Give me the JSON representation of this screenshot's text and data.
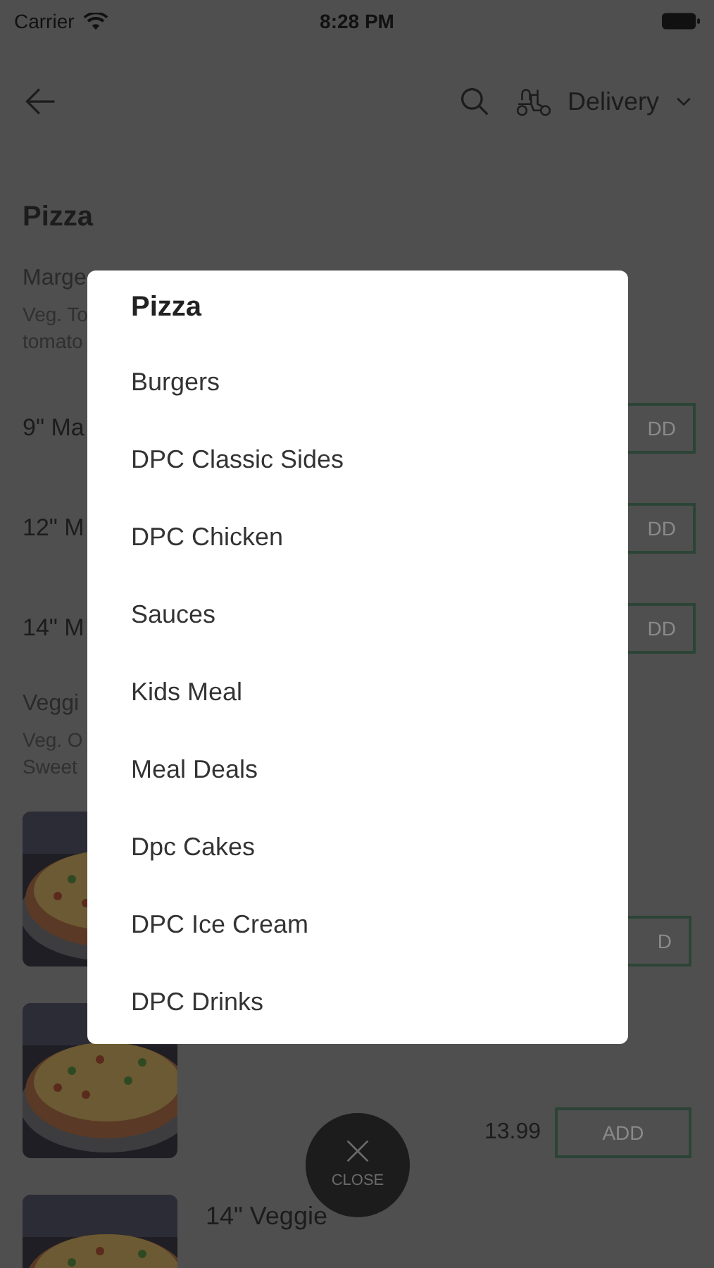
{
  "status_bar": {
    "carrier": "Carrier",
    "time": "8:28 PM"
  },
  "header": {
    "order_mode": "Delivery"
  },
  "section_title": "Pizza",
  "groups": [
    {
      "name": "Marge",
      "description": [
        "Veg. To",
        "tomato"
      ],
      "rows": [
        {
          "name": "9\" Ma",
          "button": "DD"
        },
        {
          "name": "12\" M",
          "button": "DD"
        },
        {
          "name": "14\" M",
          "button": "DD"
        }
      ]
    },
    {
      "name": "Veggi",
      "description": [
        "Veg. O",
        "Sweet"
      ]
    }
  ],
  "cards": [
    {
      "kind": "picture",
      "button": "D"
    },
    {
      "kind": "picture",
      "price": "13.99",
      "button": "ADD"
    },
    {
      "kind": "picture",
      "title": "14\" Veggie"
    }
  ],
  "category_menu": {
    "items": [
      {
        "label": "Pizza",
        "selected": true
      },
      {
        "label": "Burgers",
        "selected": false
      },
      {
        "label": "DPC Classic Sides",
        "selected": false
      },
      {
        "label": "DPC Chicken",
        "selected": false
      },
      {
        "label": "Sauces",
        "selected": false
      },
      {
        "label": "Kids Meal",
        "selected": false
      },
      {
        "label": "Meal Deals",
        "selected": false
      },
      {
        "label": "Dpc Cakes",
        "selected": false
      },
      {
        "label": "DPC Ice Cream",
        "selected": false
      },
      {
        "label": "DPC Drinks",
        "selected": false
      }
    ]
  },
  "close_button": {
    "label": "CLOSE"
  }
}
